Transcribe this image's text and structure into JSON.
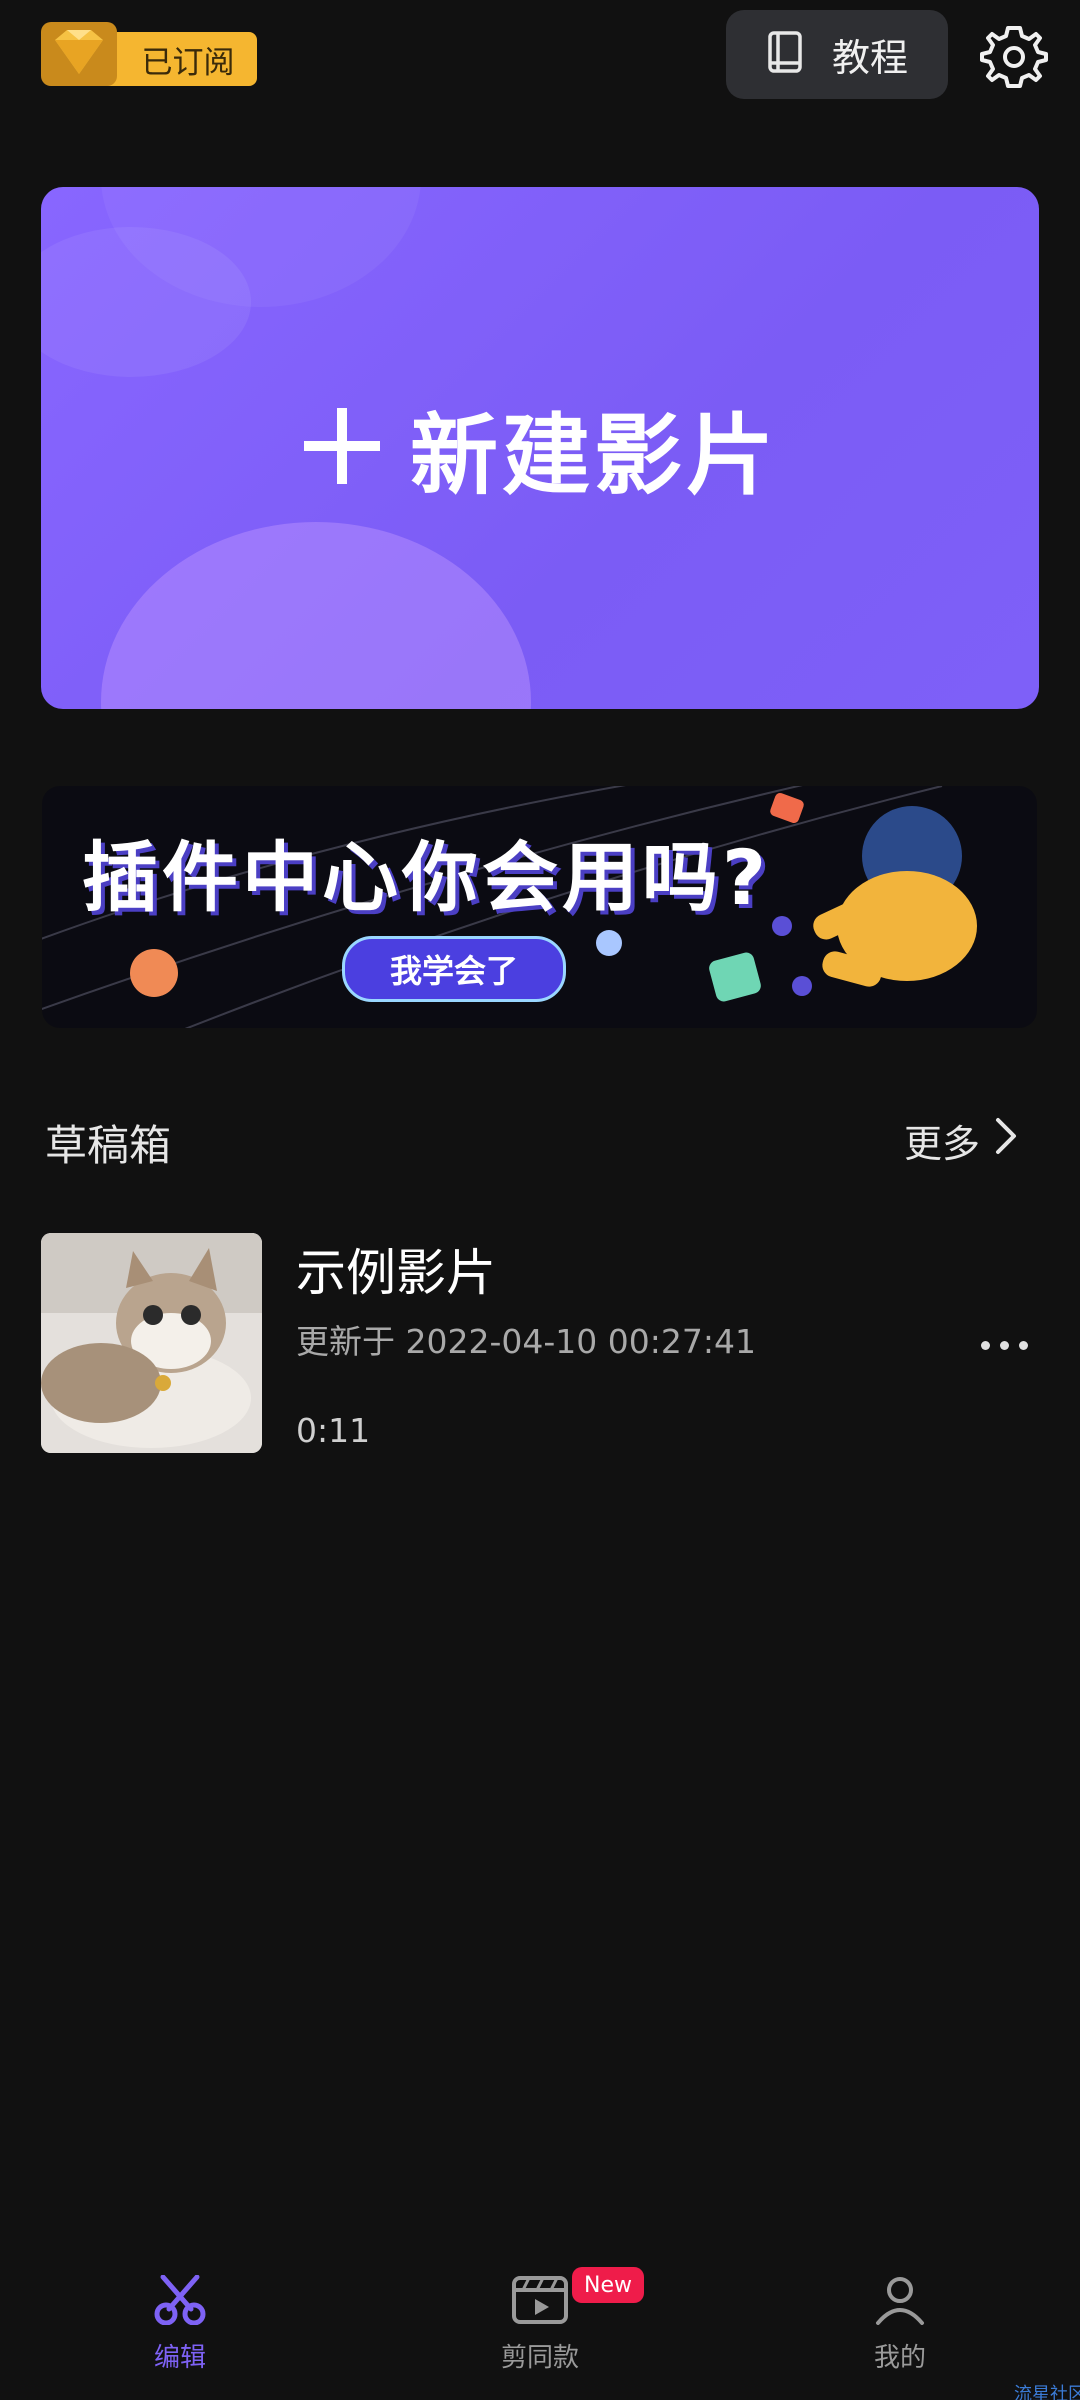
{
  "header": {
    "subscription_label": "已订阅",
    "tutorial_label": "教程"
  },
  "hero": {
    "plus_icon": "plus-icon",
    "title": "新建影片",
    "accent": "#7b5cf5"
  },
  "banner": {
    "title": "插件中心你会用吗?",
    "button_label": "我学会了"
  },
  "drafts": {
    "section_title": "草稿箱",
    "more_label": "更多",
    "items": [
      {
        "name": "示例影片",
        "updated": "更新于 2022-04-10 00:27:41",
        "duration": "0:11"
      }
    ]
  },
  "bottom_nav": {
    "items": [
      {
        "label": "编辑",
        "icon": "scissors-icon",
        "active": true
      },
      {
        "label": "剪同款",
        "icon": "clapperboard-icon",
        "active": false,
        "badge": "New"
      },
      {
        "label": "我的",
        "icon": "person-icon",
        "active": false
      }
    ]
  },
  "watermark": "流星社区"
}
